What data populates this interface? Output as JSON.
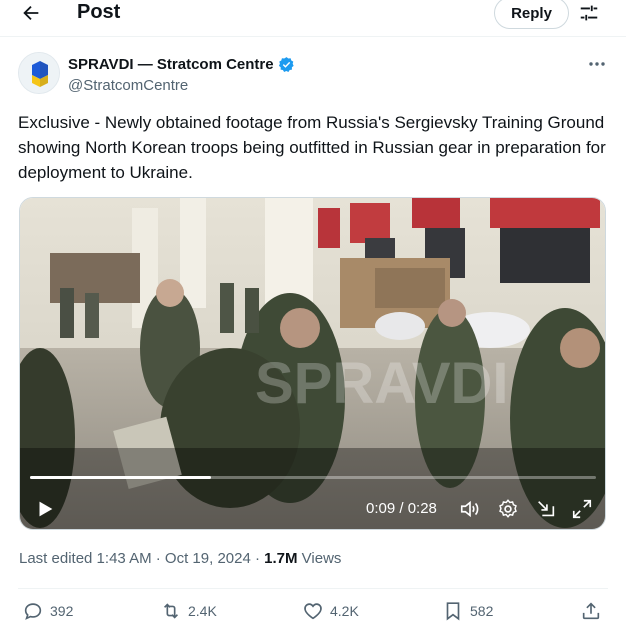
{
  "header": {
    "title": "Post",
    "reply_label": "Reply"
  },
  "author": {
    "name": "SPRAVDI — Stratcom Centre",
    "handle": "@StratcomCentre"
  },
  "tweet": {
    "text": "Exclusive - Newly obtained footage from Russia's Sergievsky Training Ground showing North Korean troops being outfitted in Russian gear in preparation for deployment to Ukraine."
  },
  "video": {
    "time": "0:09 / 0:28",
    "progress": 0.32,
    "watermark": "SPRAVDI"
  },
  "meta": {
    "edited": "Last edited 1:43 AM · Oct 19, 2024 · ",
    "views_count": "1.7M",
    "views_label": " Views"
  },
  "actions": {
    "replies": "392",
    "reposts": "2.4K",
    "likes": "4.2K",
    "bookmarks": "582"
  },
  "colors": {
    "accent": "#1d9bf0",
    "text": "#0f1419",
    "muted": "#536471"
  },
  "icons": [
    "back-arrow-icon",
    "filter-icon",
    "verified-badge-icon",
    "more-icon",
    "play-icon",
    "volume-icon",
    "settings-icon",
    "dock-icon",
    "fullscreen-icon",
    "reply-icon",
    "repost-icon",
    "like-icon",
    "bookmark-icon",
    "share-icon"
  ]
}
